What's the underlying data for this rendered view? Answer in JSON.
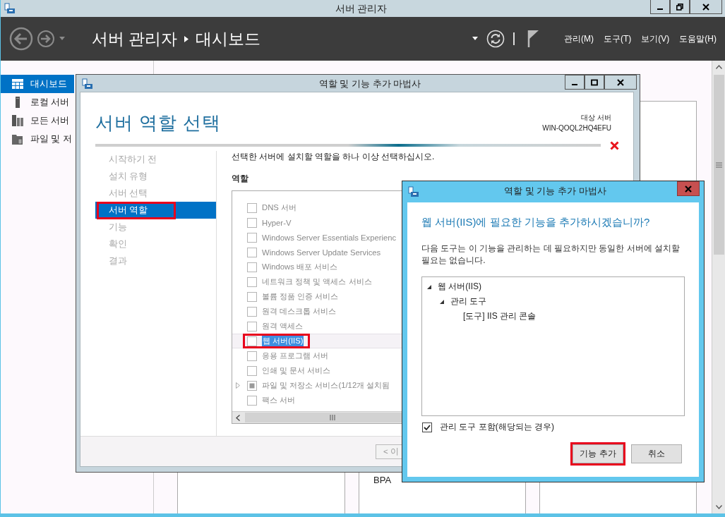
{
  "window": {
    "title": "서버 관리자"
  },
  "header": {
    "breadcrumb": [
      "서버 관리자",
      "대시보드"
    ],
    "menus": [
      "관리(M)",
      "도구(T)",
      "보기(V)",
      "도움말(H)"
    ]
  },
  "sidebar": {
    "items": [
      {
        "label": "대시보드",
        "selected": true
      },
      {
        "label": "로컬 서버",
        "selected": false
      },
      {
        "label": "모든 서버",
        "selected": false
      },
      {
        "label": "파일 및 저",
        "selected": false
      }
    ]
  },
  "dashboard": {
    "tile_text": "BPA"
  },
  "wizard": {
    "title": "역할 및 기능 추가 마법사",
    "heading": "서버 역할 선택",
    "target_label": "대상 서버",
    "target_server": "WIN-QOQL2HQ4EFU",
    "steps": [
      {
        "label": "시작하기 전",
        "selected": false,
        "marked": false
      },
      {
        "label": "설치 유형",
        "selected": false,
        "marked": false
      },
      {
        "label": "서버 선택",
        "selected": false,
        "marked": false
      },
      {
        "label": "서버 역할",
        "selected": true,
        "marked": true
      },
      {
        "label": "기능",
        "selected": false,
        "marked": false
      },
      {
        "label": "확인",
        "selected": false,
        "marked": false
      },
      {
        "label": "결과",
        "selected": false,
        "marked": false
      }
    ],
    "instruction": "선택한 서버에 설치할 역할을 하나 이상 선택하십시오.",
    "roles_header": "역할",
    "roles": [
      {
        "label": "DNS 서버",
        "checked": false,
        "partial": false,
        "expandable": false,
        "selected": false,
        "marked": false
      },
      {
        "label": "Hyper-V",
        "checked": false,
        "partial": false,
        "expandable": false,
        "selected": false,
        "marked": false
      },
      {
        "label": "Windows Server Essentials Experienc",
        "checked": false,
        "partial": false,
        "expandable": false,
        "selected": false,
        "marked": false
      },
      {
        "label": "Windows Server Update Services",
        "checked": false,
        "partial": false,
        "expandable": false,
        "selected": false,
        "marked": false
      },
      {
        "label": "Windows 배포 서비스",
        "checked": false,
        "partial": false,
        "expandable": false,
        "selected": false,
        "marked": false
      },
      {
        "label": "네트워크 정책 및 액세스 서비스",
        "checked": false,
        "partial": false,
        "expandable": false,
        "selected": false,
        "marked": false
      },
      {
        "label": "볼륨 정품 인증 서비스",
        "checked": false,
        "partial": false,
        "expandable": false,
        "selected": false,
        "marked": false
      },
      {
        "label": "원격 데스크톱 서비스",
        "checked": false,
        "partial": false,
        "expandable": false,
        "selected": false,
        "marked": false
      },
      {
        "label": "원격 액세스",
        "checked": false,
        "partial": false,
        "expandable": false,
        "selected": false,
        "marked": false
      },
      {
        "label": "웹 서버(IIS)",
        "checked": false,
        "partial": false,
        "expandable": false,
        "selected": true,
        "marked": true
      },
      {
        "label": "응용 프로그램 서버",
        "checked": false,
        "partial": false,
        "expandable": false,
        "selected": false,
        "marked": false
      },
      {
        "label": "인쇄 및 문서 서비스",
        "checked": false,
        "partial": false,
        "expandable": false,
        "selected": false,
        "marked": false
      },
      {
        "label": "파일 및 저장소 서비스(1/12개 설치됨",
        "checked": false,
        "partial": true,
        "expandable": true,
        "selected": false,
        "marked": false
      },
      {
        "label": "팩스 서버",
        "checked": false,
        "partial": false,
        "expandable": false,
        "selected": false,
        "marked": false
      }
    ],
    "back_button": "< 이"
  },
  "dialog": {
    "title": "역할 및 기능 추가 마법사",
    "question": "웹 서버(IIS)에 필요한 기능을 추가하시겠습니까?",
    "message": "다음 도구는 이 기능을 관리하는 데 필요하지만 동일한 서버에 설치할 필요는 없습니다.",
    "features": [
      {
        "label": "웹 서버(IIS)",
        "expanded": true,
        "children": [
          {
            "label": "관리 도구",
            "expanded": true,
            "children": [
              {
                "label": "[도구] IIS 관리 콘솔"
              }
            ]
          }
        ]
      }
    ],
    "include_tools": {
      "label": "관리 도구 포함(해당되는 경우)",
      "checked": true
    },
    "buttons": [
      {
        "label": "기능 추가",
        "marked": true
      },
      {
        "label": "취소",
        "marked": false
      }
    ]
  }
}
